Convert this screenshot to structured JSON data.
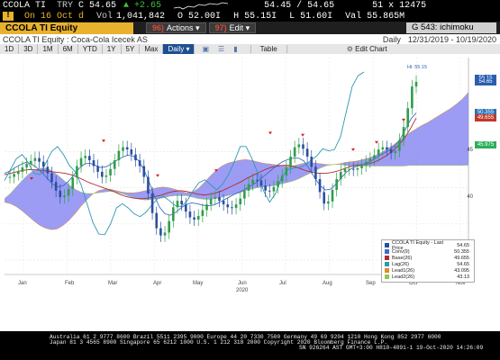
{
  "quote_line1": {
    "ticker": "CCOLA TI",
    "currency": "TRY",
    "price": "C 54.65",
    "change": "+2.65",
    "bid_ask": "54.45 / 54.65",
    "size": "51 x 12475"
  },
  "quote_line2": {
    "timestamp": "On 16 Oct d",
    "volume_label": "Vol",
    "volume": "1,041,842",
    "open": "O 52.00I",
    "high": "H 55.15I",
    "low": "L 51.60I",
    "val": "Val 55.865M"
  },
  "command_bar": {
    "security": "CCOLA TI Equity",
    "actions_num": "96)",
    "actions_label": "Actions",
    "edit_num": "97)",
    "edit_label": "Edit",
    "page_code": "G 543: ichimoku"
  },
  "title_bar": {
    "title": "CCOLA TI Equity : Coca-Cola Icecek AS",
    "period": "Daily",
    "range": "12/31/2019 - 10/19/2020"
  },
  "toolbar": {
    "periods": [
      "1D",
      "3D",
      "1M",
      "6M",
      "YTD",
      "1Y",
      "5Y",
      "Max"
    ],
    "frequency": "Daily",
    "table_label": "Table",
    "edit_chart_label": "Edit Chart"
  },
  "chart_data": {
    "type": "line",
    "title": "CCOLA TI Equity - Last Price",
    "x_labels": [
      "Jan",
      "Feb",
      "Mar",
      "Apr",
      "May",
      "Jun",
      "Jul",
      "Aug",
      "Sep",
      "Oct",
      "Nov"
    ],
    "year_label": "2020",
    "y_ticks": [
      45,
      40,
      35,
      30
    ],
    "ylim": [
      28,
      58
    ],
    "high_annotation": "Hi: 55.15",
    "price_tags": [
      {
        "label": "55.15",
        "value": 55.15,
        "color": "#2a5fb0"
      },
      {
        "label": "54.65",
        "value": 54.65,
        "color": "#2a5fb0"
      },
      {
        "label": "50.355",
        "value": 50.355,
        "color": "#2a72b8"
      },
      {
        "label": "49.655",
        "value": 49.655,
        "color": "#c0392b"
      },
      {
        "label": "45.975",
        "value": 45.975,
        "color": "#2eaf5c"
      }
    ],
    "series_colors": {
      "last_price": "#2a4fa0",
      "conv": "#3a6fc0",
      "base": "#b02a2a",
      "lag": "#2a9ab0",
      "cloud": "#7b7bf0"
    },
    "legend": [
      {
        "name": "CCOLA TI Equity - Last Price",
        "value": "54.65",
        "color": "#2a4fa0"
      },
      {
        "name": "Conv(9)",
        "value": "50.355",
        "color": "#3a6fc0"
      },
      {
        "name": "Base(26)",
        "value": "49.655",
        "color": "#b02a2a"
      },
      {
        "name": "Lag(26)",
        "value": "54.65",
        "color": "#2a9ab0"
      },
      {
        "name": "Lead1(26)",
        "value": "43.095",
        "color": "#e08a2a"
      },
      {
        "name": "Lead2(26)",
        "value": "43.13",
        "color": "#8ac850"
      }
    ],
    "last_price": [
      41.5,
      41.9,
      42.2,
      42.8,
      43.3,
      43.7,
      44.1,
      43.6,
      42.9,
      42.0,
      40.8,
      39.6,
      38.7,
      38.9,
      39.8,
      41.4,
      43.0,
      44.1,
      44.4,
      43.8,
      43.0,
      42.2,
      41.5,
      41.7,
      42.6,
      43.8,
      45.1,
      45.6,
      45.3,
      44.6,
      43.8,
      43.0,
      41.5,
      39.2,
      36.5,
      34.4,
      33.4,
      33.8,
      35.4,
      37.3,
      38.2,
      37.7,
      36.7,
      35.9,
      35.6,
      36.1,
      36.9,
      37.7,
      38.5,
      38.7,
      38.2,
      37.7,
      37.3,
      37.2,
      37.7,
      38.5,
      39.6,
      40.5,
      41.1,
      41.0,
      40.3,
      39.6,
      39.5,
      40.1,
      40.9,
      41.7,
      42.8,
      44.3,
      45.6,
      46.0,
      45.4,
      44.3,
      42.9,
      41.2,
      39.4,
      37.8,
      38.1,
      39.7,
      41.2,
      42.2,
      42.6,
      42.6,
      42.5,
      42.7,
      43.1,
      43.6,
      44.0,
      44.5,
      45.3,
      45.6,
      45.3,
      44.8,
      45.1,
      46.6,
      48.4,
      51.0,
      54.0,
      54.65
    ],
    "conv": [
      42.0,
      42.3,
      42.8,
      43.2,
      43.5,
      43.3,
      42.8,
      42.1,
      41.3,
      40.5,
      40.1,
      40.3,
      40.9,
      41.8,
      42.7,
      43.3,
      43.4,
      43.1,
      42.8,
      42.9,
      43.3,
      43.8,
      44.2,
      44.5,
      44.4,
      43.8,
      42.6,
      40.9,
      38.9,
      37.3,
      36.4,
      36.2,
      36.6,
      37.2,
      37.7,
      37.9,
      37.8,
      37.6,
      37.5,
      37.6,
      37.9,
      38.3,
      38.7,
      39.1,
      39.4,
      39.8,
      40.2,
      40.7,
      41.3,
      41.9,
      42.5,
      43.1,
      43.6,
      43.9,
      44.1,
      44.1,
      43.7,
      42.6,
      41.4,
      40.3,
      39.7,
      39.8,
      40.5,
      41.4,
      42.2,
      42.7,
      43.0,
      43.2,
      43.5,
      43.9,
      44.4,
      44.8,
      45.2,
      45.8,
      46.7,
      48.1,
      49.5,
      50.355
    ],
    "base": [
      41.8,
      42.0,
      42.2,
      42.4,
      42.5,
      42.5,
      42.4,
      42.3,
      42.2,
      42.1,
      42.0,
      41.8,
      41.5,
      41.1,
      40.7,
      40.4,
      40.1,
      39.8,
      39.5,
      39.1,
      38.8,
      38.6,
      38.5,
      38.5,
      38.6,
      38.8,
      39.0,
      39.3,
      39.5,
      39.6,
      39.5,
      39.3,
      39.1,
      39.0,
      39.1,
      39.3,
      39.6,
      40.0,
      40.4,
      40.8,
      41.3,
      41.7,
      42.1,
      42.5,
      42.8,
      43.0,
      43.1,
      43.1,
      42.9,
      42.6,
      42.3,
      42.1,
      42.0,
      42.0,
      42.1,
      42.3,
      42.6,
      42.9,
      43.1,
      43.2,
      43.3,
      43.5,
      43.9,
      44.4,
      45.0,
      45.8,
      46.8,
      48.1,
      49.655
    ],
    "lag": [
      41.0,
      42.5,
      44.0,
      44.6,
      43.5,
      42.0,
      41.8,
      43.4,
      45.0,
      45.7,
      44.6,
      43.1,
      42.2,
      40.4,
      37.8,
      35.2,
      33.6,
      33.5,
      35.0,
      37.2,
      37.8,
      37.2,
      36.4,
      36.0,
      36.6,
      37.6,
      38.5,
      38.8,
      38.2,
      37.5,
      37.4,
      38.2,
      39.6,
      40.7,
      41.1,
      40.4,
      39.7,
      40.5,
      41.8,
      43.6,
      45.7,
      45.7,
      44.0,
      42.0,
      39.5,
      38.0,
      39.2,
      41.4,
      42.5,
      42.7,
      42.8,
      43.1,
      43.8,
      44.4,
      45.4,
      45.1,
      45.3,
      47.0,
      50.5,
      54.0,
      55.5,
      56.0
    ],
    "lead1": [
      38.0,
      37.8,
      37.4,
      36.8,
      36.1,
      35.4,
      34.8,
      34.4,
      34.2,
      34.3,
      34.8,
      35.5,
      36.4,
      37.4,
      38.3,
      39.1,
      39.6,
      39.8,
      39.8,
      39.6,
      39.4,
      39.3,
      39.3,
      39.4,
      39.6,
      39.8,
      40.0,
      40.1,
      40.0,
      39.8,
      39.5,
      39.3,
      39.4,
      39.9,
      40.7,
      41.6,
      42.4,
      43.0,
      43.4,
      43.6,
      43.8,
      43.9,
      43.8,
      43.6,
      43.4,
      43.3,
      43.2,
      43.1,
      43.0,
      43.0,
      43.2,
      43.4,
      43.5,
      43.4,
      43.3,
      43.2,
      43.2,
      43.3,
      43.5,
      43.6,
      43.7,
      43.9,
      44.1,
      44.4,
      44.8,
      45.3,
      45.8,
      46.4,
      47.0,
      47.6,
      48.1,
      48.6,
      49.0,
      49.5,
      50.0,
      50.5,
      51.0,
      51.6,
      52.3,
      53.2
    ],
    "lead2": [
      38.5,
      39.2,
      40.1,
      41.0,
      41.8,
      42.4,
      42.7,
      42.7,
      42.4,
      41.8,
      41.1,
      40.4,
      39.8,
      39.4,
      39.2,
      39.2,
      39.3,
      39.4,
      39.5,
      39.4,
      39.2,
      38.9,
      38.6,
      38.4,
      38.3,
      38.4,
      38.5,
      38.6,
      38.8,
      38.9,
      38.9,
      38.9,
      38.7,
      38.5,
      38.4,
      38.4,
      38.5,
      38.7,
      38.9,
      39.1,
      39.3,
      39.6,
      39.8,
      40.0,
      40.1,
      40.2,
      40.3,
      40.5,
      40.7,
      40.9,
      41.2,
      41.6,
      42.0,
      42.4,
      42.8,
      43.1,
      43.2,
      43.2,
      43.1,
      43.0,
      43.0,
      43.0,
      43.0,
      43.0,
      43.0,
      43.0,
      43.0,
      43.0,
      43.0,
      43.1,
      43.1,
      43.1,
      43.1,
      43.1,
      43.1,
      43.1,
      43.1,
      43.1,
      43.1,
      43.13
    ]
  },
  "footer": {
    "line1": "Australia 61 2 9777 8600 Brazil 5511 2395 9000 Europe 44 20 7330 7500 Germany 49 69 9204 1210 Hong Kong 852 2977 6000",
    "line2": "Japan 81 3 4565 8900         Singapore 65 6212 1000          U.S. 1 212 318 2000           Copyright 2020 Bloomberg Finance L.P.",
    "line3": "SN 926264 AST  GMT+3:00 H810-4891-1 19-Oct-2020 14:26:09"
  }
}
